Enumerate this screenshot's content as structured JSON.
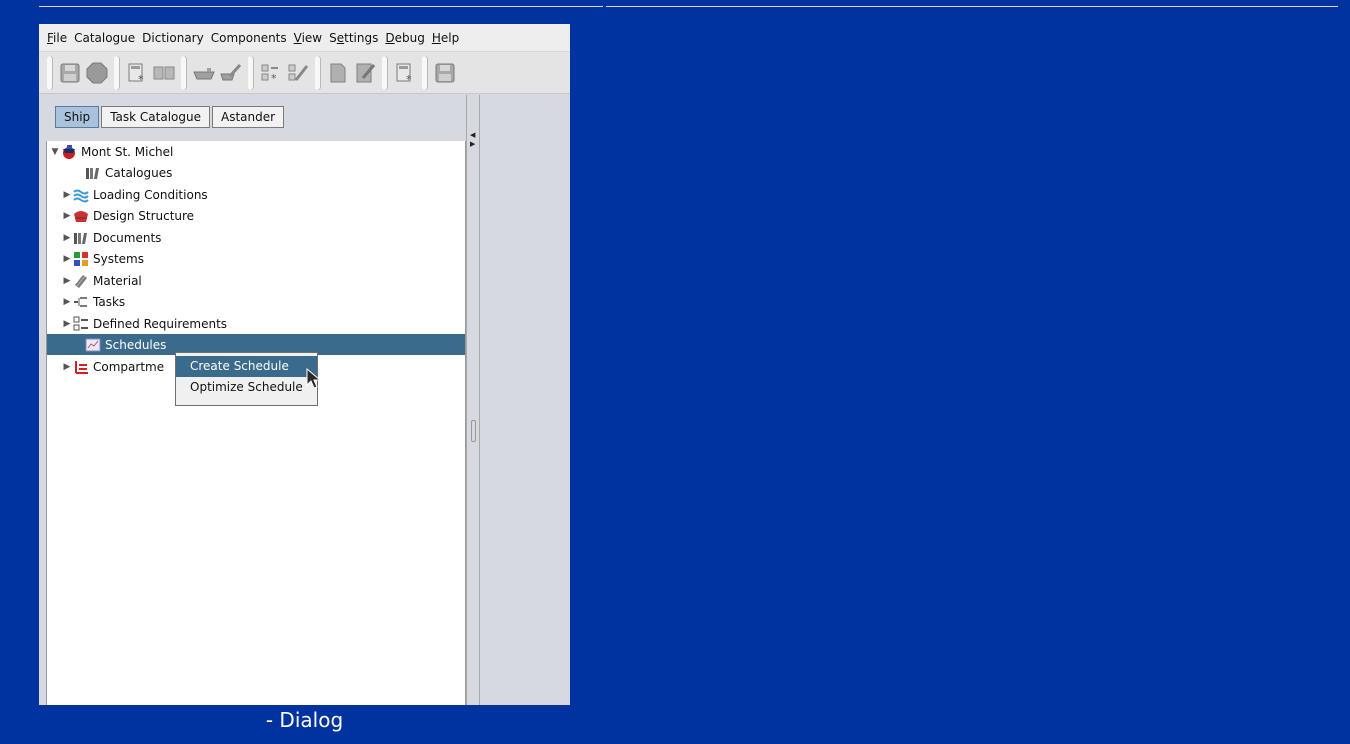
{
  "window": {
    "title": "- Dialog"
  },
  "menu": {
    "items": [
      {
        "pre": "",
        "u": "F",
        "post": "ile"
      },
      {
        "pre": "Catalogue",
        "u": "",
        "post": ""
      },
      {
        "pre": "Dictionary",
        "u": "",
        "post": ""
      },
      {
        "pre": "Components",
        "u": "",
        "post": ""
      },
      {
        "pre": "",
        "u": "V",
        "post": "iew"
      },
      {
        "pre": "S",
        "u": "e",
        "post": "ttings"
      },
      {
        "pre": "",
        "u": "D",
        "post": "ebug"
      },
      {
        "pre": "",
        "u": "H",
        "post": "elp"
      }
    ]
  },
  "toolbar": {
    "icons": [
      "save-icon",
      "stop-icon",
      "new-document-icon",
      "book-icon",
      "ship-icon",
      "edit-ship-icon",
      "checklist-new-icon",
      "checklist-edit-icon",
      "document-new-icon",
      "document-edit-icon",
      "new-document-icon",
      "save-icon"
    ]
  },
  "tabs": [
    {
      "label": "Ship",
      "active": true
    },
    {
      "label": "Task Catalogue",
      "active": false
    },
    {
      "label": "Astander",
      "active": false
    }
  ],
  "tree": {
    "root": "Mont St. Michel",
    "items": [
      {
        "label": "Catalogues",
        "icon": "catalogues-icon",
        "expandable": false
      },
      {
        "label": "Loading Conditions",
        "icon": "waves-icon",
        "expandable": true
      },
      {
        "label": "Design Structure",
        "icon": "hull-icon",
        "expandable": true
      },
      {
        "label": "Documents",
        "icon": "documents-icon",
        "expandable": true
      },
      {
        "label": "Systems",
        "icon": "systems-icon",
        "expandable": true
      },
      {
        "label": "Material",
        "icon": "material-icon",
        "expandable": true
      },
      {
        "label": "Tasks",
        "icon": "tasks-icon",
        "expandable": true
      },
      {
        "label": "Defined Requirements",
        "icon": "requirements-icon",
        "expandable": true
      },
      {
        "label": "Schedules",
        "icon": "schedules-icon",
        "expandable": false,
        "selected": true
      },
      {
        "label": "Compartme",
        "icon": "compartments-icon",
        "expandable": true
      }
    ]
  },
  "context_menu": {
    "items": [
      {
        "label": "Create Schedule",
        "hover": true
      },
      {
        "label": "Optimize Schedule",
        "hover": false
      }
    ]
  },
  "colors": {
    "desktop": "#0033a0",
    "selection": "#3a6a8c",
    "active_tab": "#a9c3dc"
  }
}
